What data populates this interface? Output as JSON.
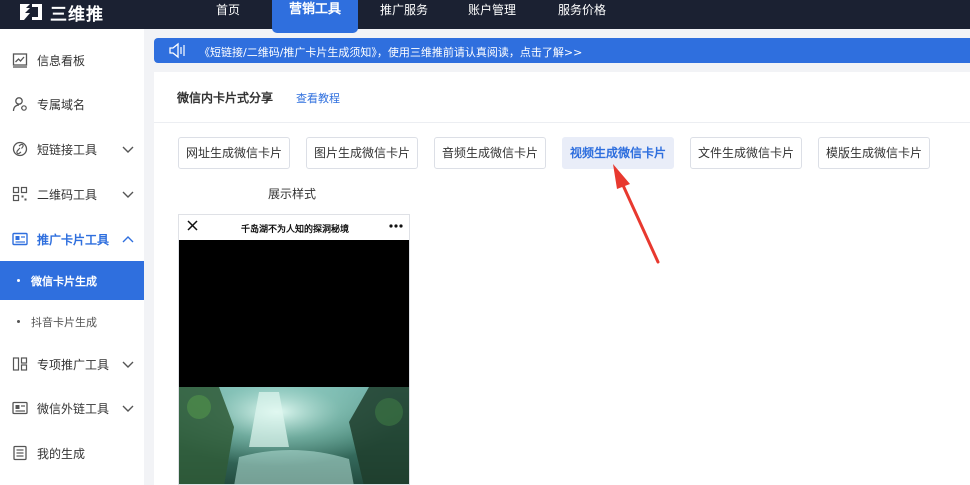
{
  "app": {
    "brand": "三维推",
    "brand_color": "#2f6fde",
    "topbar_color": "#1b2132"
  },
  "nav": {
    "items": [
      {
        "label": "首页",
        "active": false
      },
      {
        "label": "营销工具",
        "active": true
      },
      {
        "label": "推广服务",
        "active": false
      },
      {
        "label": "账户管理",
        "active": false
      },
      {
        "label": "服务价格",
        "active": false
      }
    ]
  },
  "sidebar": {
    "items": [
      {
        "label": "信息看板",
        "icon": "dashboard-icon"
      },
      {
        "label": "专属域名",
        "icon": "user-domain-icon"
      },
      {
        "label": "短链接工具",
        "icon": "link-icon",
        "expandable": true
      },
      {
        "label": "二维码工具",
        "icon": "qrcode-icon",
        "expandable": true
      },
      {
        "label": "推广卡片工具",
        "icon": "card-icon",
        "expandable": true,
        "expanded": true,
        "children": [
          {
            "label": "微信卡片生成",
            "active": true
          },
          {
            "label": "抖音卡片生成",
            "active": false
          }
        ]
      },
      {
        "label": "专项推广工具",
        "icon": "special-tools-icon",
        "expandable": true
      },
      {
        "label": "微信外链工具",
        "icon": "wechat-link-icon",
        "expandable": true
      },
      {
        "label": "我的生成",
        "icon": "list-icon"
      }
    ]
  },
  "notice": {
    "text": "《短链接/二维码/推广卡片生成须知》，使用三维推前请认真阅读，点击了解>>"
  },
  "page": {
    "title": "微信内卡片式分享",
    "tutorial_link": "查看教程",
    "tabs": [
      {
        "label": "网址生成微信卡片",
        "active": false
      },
      {
        "label": "图片生成微信卡片",
        "active": false
      },
      {
        "label": "音频生成微信卡片",
        "active": false
      },
      {
        "label": "视频生成微信卡片",
        "active": true
      },
      {
        "label": "文件生成微信卡片",
        "active": false
      },
      {
        "label": "模版生成微信卡片",
        "active": false
      }
    ],
    "preview_label": "展示样式",
    "preview": {
      "title": "千岛湖不为人知的探洞秘境"
    }
  }
}
